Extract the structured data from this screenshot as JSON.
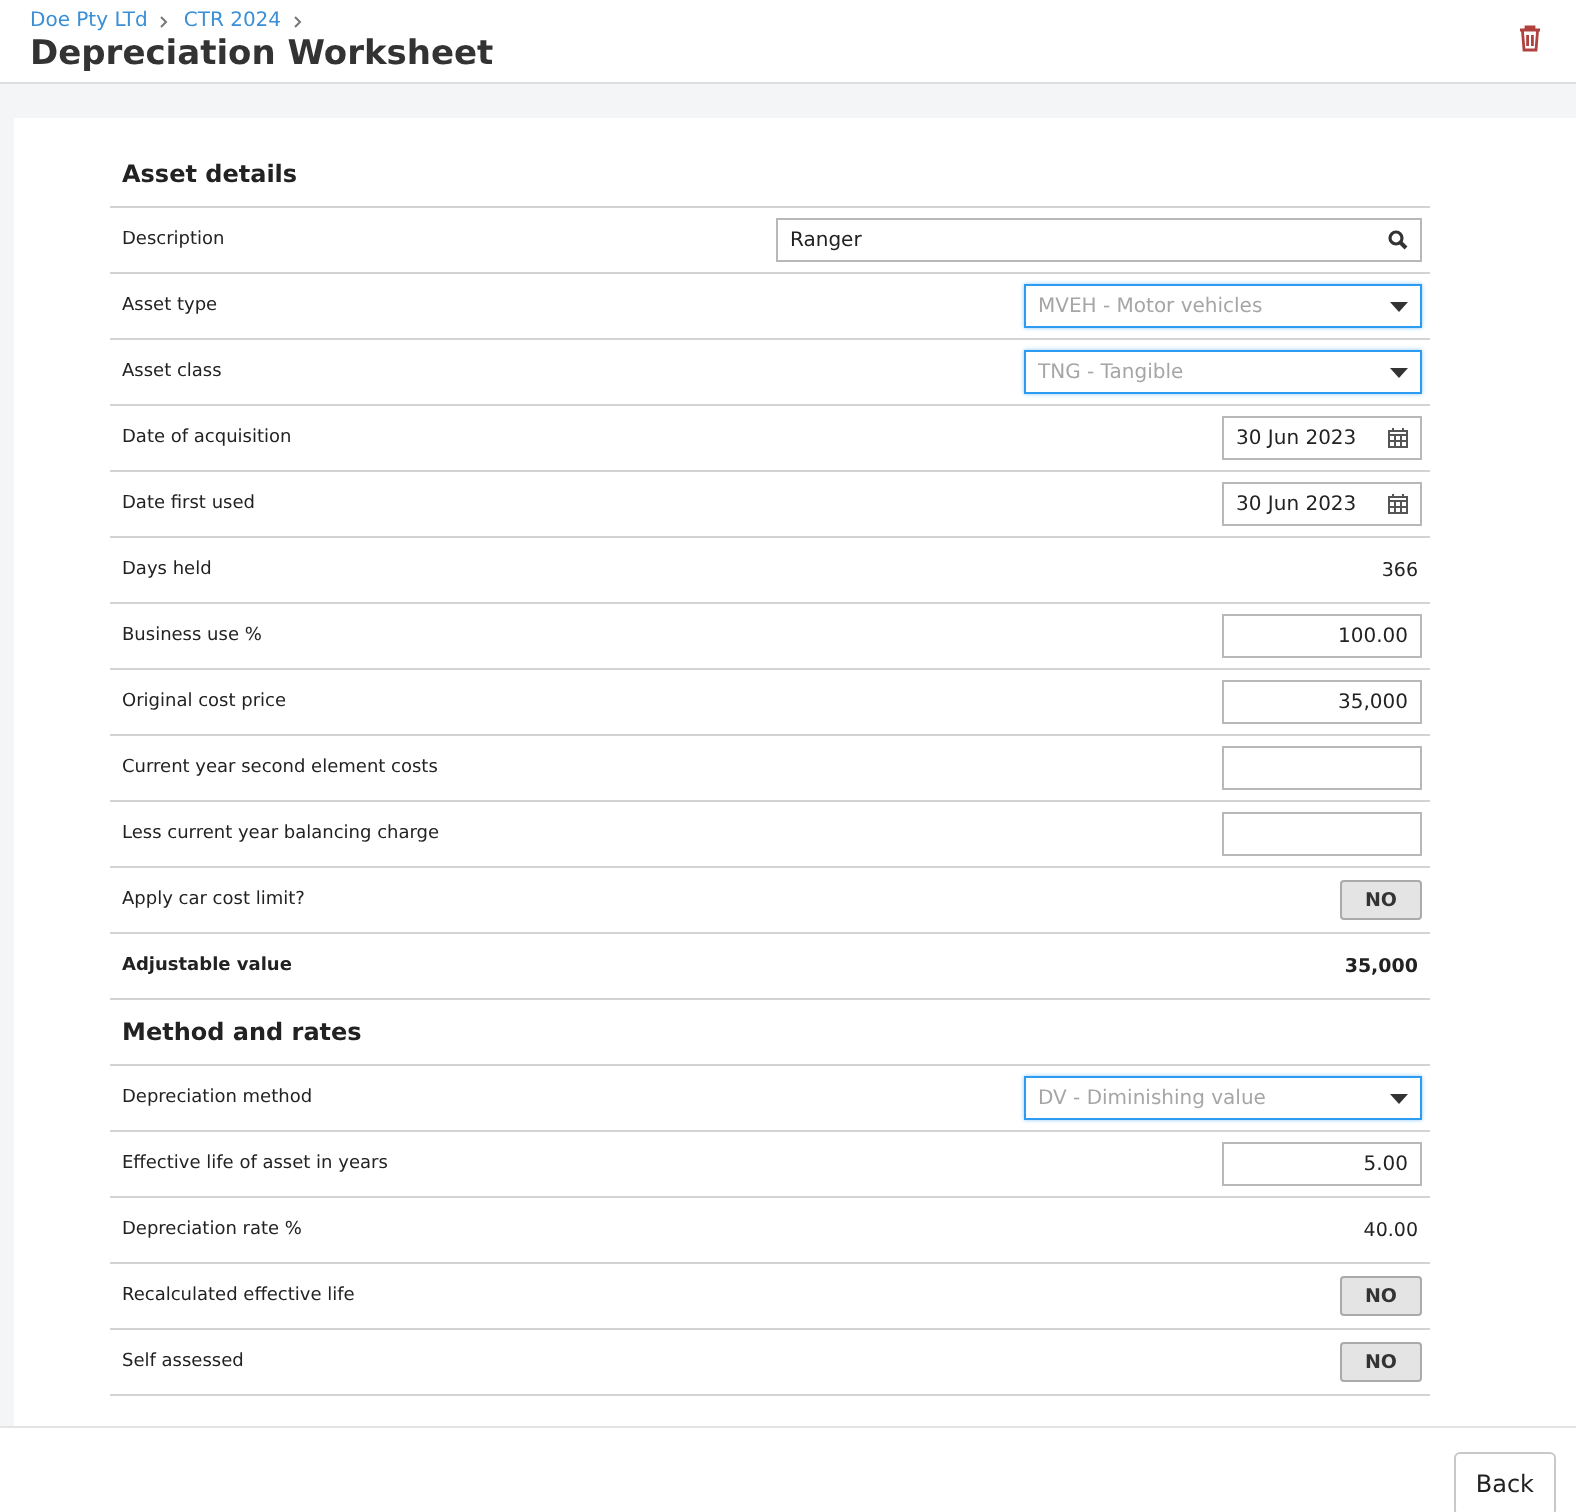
{
  "breadcrumbs": [
    "Doe Pty LTd",
    "CTR 2024"
  ],
  "title": "Depreciation Worksheet",
  "sections": [
    {
      "heading": "Asset details",
      "rows": [
        {
          "label": "Description",
          "kind": "search",
          "value": "Ranger"
        },
        {
          "label": "Asset type",
          "kind": "select",
          "value": "MVEH - Motor vehicles"
        },
        {
          "label": "Asset class",
          "kind": "select",
          "value": "TNG - Tangible"
        },
        {
          "label": "Date of acquisition",
          "kind": "date",
          "value": "30 Jun 2023"
        },
        {
          "label": "Date first used",
          "kind": "date",
          "value": "30 Jun 2023"
        },
        {
          "label": "Days held",
          "kind": "text",
          "value": "366"
        },
        {
          "label": "Business use %",
          "kind": "input",
          "value": "100.00"
        },
        {
          "label": "Original cost price",
          "kind": "input",
          "value": "35,000"
        },
        {
          "label": "Current year second element costs",
          "kind": "input"
        },
        {
          "label": "Less current year balancing charge",
          "kind": "input"
        },
        {
          "label": "Apply car cost limit?",
          "kind": "toggle",
          "value": "NO",
          "on": false
        },
        {
          "label": "Adjustable value",
          "kind": "total",
          "value": "35,000"
        }
      ]
    },
    {
      "heading": "Method and rates",
      "rows": [
        {
          "label": "Depreciation method",
          "kind": "select",
          "value": "DV - Diminishing value"
        },
        {
          "label": "Effective life of asset in years",
          "kind": "input",
          "value": "5.00"
        },
        {
          "label": "Depreciation rate %",
          "kind": "text",
          "value": "40.00"
        },
        {
          "label": "Recalculated effective life",
          "kind": "toggle",
          "value": "NO",
          "on": false
        },
        {
          "label": "Self assessed",
          "kind": "toggle",
          "value": "NO",
          "on": false
        }
      ]
    }
  ],
  "footer_button": "Back"
}
